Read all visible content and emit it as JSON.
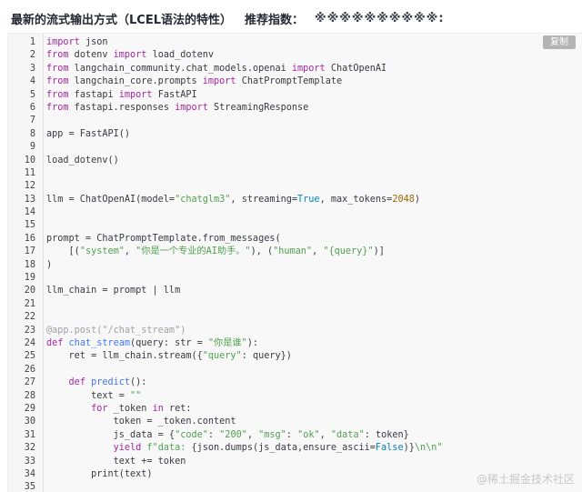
{
  "header": {
    "title": "最新的流式输出方式（LCEL语法的特性）",
    "rating_label": "推荐指数：",
    "stars": "※※※※※※※※※※:"
  },
  "toolbar": {
    "copy_label": "复制"
  },
  "watermark": "@稀土掘金技术社区",
  "code_lines": [
    {
      "n": "1",
      "t": [
        [
          "kw",
          "import"
        ],
        [
          "",
          " json"
        ]
      ]
    },
    {
      "n": "2",
      "t": [
        [
          "kw",
          "from"
        ],
        [
          "",
          " dotenv "
        ],
        [
          "kw",
          "import"
        ],
        [
          "",
          " load_dotenv"
        ]
      ]
    },
    {
      "n": "3",
      "t": [
        [
          "kw",
          "from"
        ],
        [
          "",
          " langchain_community.chat_models.openai "
        ],
        [
          "kw",
          "import"
        ],
        [
          "",
          " ChatOpenAI"
        ]
      ]
    },
    {
      "n": "4",
      "t": [
        [
          "kw",
          "from"
        ],
        [
          "",
          " langchain_core.prompts "
        ],
        [
          "kw",
          "import"
        ],
        [
          "",
          " ChatPromptTemplate"
        ]
      ]
    },
    {
      "n": "5",
      "t": [
        [
          "kw",
          "from"
        ],
        [
          "",
          " fastapi "
        ],
        [
          "kw",
          "import"
        ],
        [
          "",
          " FastAPI"
        ]
      ]
    },
    {
      "n": "6",
      "t": [
        [
          "kw",
          "from"
        ],
        [
          "",
          " fastapi.responses "
        ],
        [
          "kw",
          "import"
        ],
        [
          "",
          " StreamingResponse"
        ]
      ]
    },
    {
      "n": "7",
      "t": []
    },
    {
      "n": "8",
      "t": [
        [
          "",
          "app = FastAPI()"
        ]
      ]
    },
    {
      "n": "9",
      "t": []
    },
    {
      "n": "10",
      "t": [
        [
          "",
          "load_dotenv()"
        ]
      ]
    },
    {
      "n": "11",
      "t": []
    },
    {
      "n": "12",
      "t": []
    },
    {
      "n": "13",
      "t": [
        [
          "",
          "llm = ChatOpenAI(model="
        ],
        [
          "str",
          "\"chatglm3\""
        ],
        [
          "",
          ", streaming="
        ],
        [
          "lit",
          "True"
        ],
        [
          "",
          ", max_tokens="
        ],
        [
          "num",
          "2048"
        ],
        [
          "",
          ")"
        ]
      ]
    },
    {
      "n": "14",
      "t": []
    },
    {
      "n": "15",
      "t": []
    },
    {
      "n": "16",
      "t": [
        [
          "",
          "prompt = ChatPromptTemplate.from_messages("
        ]
      ]
    },
    {
      "n": "17",
      "t": [
        [
          "",
          "    [("
        ],
        [
          "str",
          "\"system\""
        ],
        [
          "",
          ", "
        ],
        [
          "str",
          "\"你是一个专业的AI助手。\""
        ],
        [
          "",
          "), ("
        ],
        [
          "str",
          "\"human\""
        ],
        [
          "",
          ", "
        ],
        [
          "str",
          "\"{query}\""
        ],
        [
          "",
          ")]"
        ]
      ]
    },
    {
      "n": "18",
      "t": [
        [
          "",
          ")"
        ]
      ]
    },
    {
      "n": "19",
      "t": []
    },
    {
      "n": "20",
      "t": [
        [
          "",
          "llm_chain = prompt | llm"
        ]
      ]
    },
    {
      "n": "21",
      "t": []
    },
    {
      "n": "22",
      "t": []
    },
    {
      "n": "23",
      "t": [
        [
          "cm",
          "@app.post(\"/chat_stream\")"
        ]
      ]
    },
    {
      "n": "24",
      "t": [
        [
          "kw",
          "def"
        ],
        [
          "",
          " "
        ],
        [
          "fn",
          "chat_stream"
        ],
        [
          "",
          "(query: str = "
        ],
        [
          "str",
          "\"你是谁\""
        ],
        [
          "",
          "):"
        ]
      ]
    },
    {
      "n": "25",
      "t": [
        [
          "",
          "    ret = llm_chain.stream({"
        ],
        [
          "str",
          "\"query\""
        ],
        [
          "",
          ": query})"
        ]
      ]
    },
    {
      "n": "26",
      "t": []
    },
    {
      "n": "27",
      "t": [
        [
          "",
          "    "
        ],
        [
          "kw",
          "def"
        ],
        [
          "",
          " "
        ],
        [
          "fn",
          "predict"
        ],
        [
          "",
          "():"
        ]
      ]
    },
    {
      "n": "28",
      "t": [
        [
          "",
          "        text = "
        ],
        [
          "str",
          "\"\""
        ]
      ]
    },
    {
      "n": "29",
      "t": [
        [
          "",
          "        "
        ],
        [
          "kw",
          "for"
        ],
        [
          "",
          " _token "
        ],
        [
          "kw",
          "in"
        ],
        [
          "",
          " ret:"
        ]
      ]
    },
    {
      "n": "30",
      "t": [
        [
          "",
          "            token = _token.content"
        ]
      ]
    },
    {
      "n": "31",
      "t": [
        [
          "",
          "            js_data = {"
        ],
        [
          "str",
          "\"code\""
        ],
        [
          "",
          ": "
        ],
        [
          "str",
          "\"200\""
        ],
        [
          "",
          ", "
        ],
        [
          "str",
          "\"msg\""
        ],
        [
          "",
          ": "
        ],
        [
          "str",
          "\"ok\""
        ],
        [
          "",
          ", "
        ],
        [
          "str",
          "\"data\""
        ],
        [
          "",
          ": token}"
        ]
      ]
    },
    {
      "n": "32",
      "t": [
        [
          "",
          "            "
        ],
        [
          "kw",
          "yield"
        ],
        [
          "",
          " "
        ],
        [
          "str",
          "f\"data: "
        ],
        [
          "",
          "{json.dumps(js_data,ensure_ascii="
        ],
        [
          "lit",
          "False"
        ],
        [
          "",
          ")}"
        ],
        [
          "str",
          "\\n\\n\""
        ]
      ]
    },
    {
      "n": "33",
      "t": [
        [
          "",
          "            text += token"
        ]
      ]
    },
    {
      "n": "34",
      "t": [
        [
          "",
          "        print(text)"
        ]
      ]
    },
    {
      "n": "35",
      "t": []
    }
  ]
}
